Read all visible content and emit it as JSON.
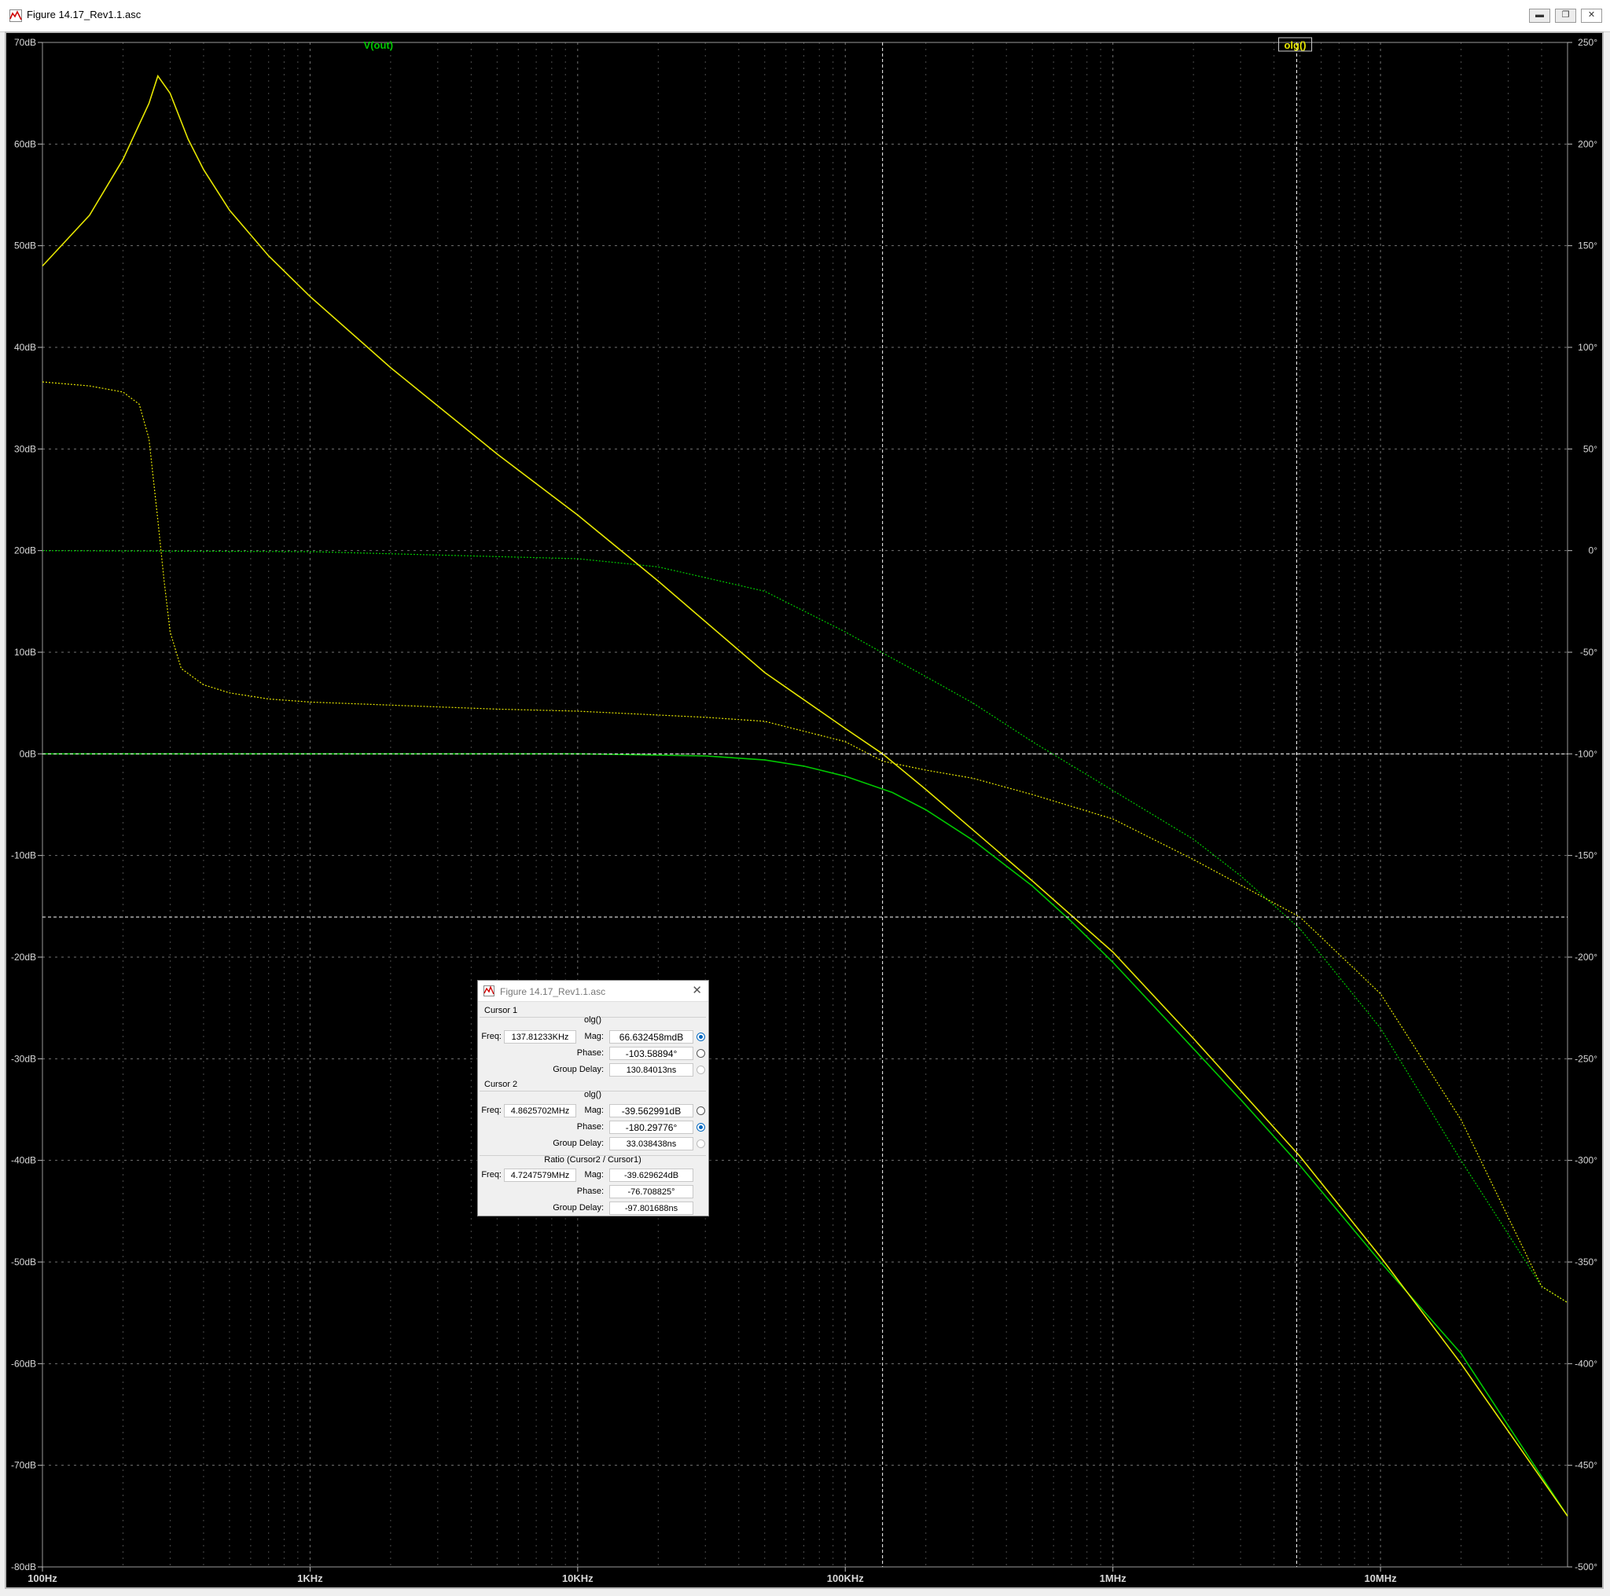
{
  "window": {
    "title": "Figure 14.17_Rev1.1.asc"
  },
  "window_buttons": {
    "minimize": "▬",
    "restore": "❐",
    "close": "✕"
  },
  "icons": {
    "app": "ltspice-plot-icon",
    "dialog": "ltspice-plot-icon"
  },
  "colors": {
    "background": "#000000",
    "grid": "#7f7f7f",
    "trace_vout": "#00c800",
    "trace_olg": "#e6e600",
    "cursor": "#ffffff"
  },
  "chart_data": {
    "type": "line",
    "xscale": "log",
    "xlim": [
      100,
      50000000
    ],
    "x_ticks": [
      {
        "value": 100,
        "label": "100Hz"
      },
      {
        "value": 1000,
        "label": "1KHz"
      },
      {
        "value": 10000,
        "label": "10KHz"
      },
      {
        "value": 100000,
        "label": "100KHz"
      },
      {
        "value": 1000000,
        "label": "1MHz"
      },
      {
        "value": 10000000,
        "label": "10MHz"
      }
    ],
    "ylim_left": [
      -80,
      70
    ],
    "y_left_ticks": [
      "70dB",
      "60dB",
      "50dB",
      "40dB",
      "30dB",
      "20dB",
      "10dB",
      "0dB",
      "-10dB",
      "-20dB",
      "-30dB",
      "-40dB",
      "-50dB",
      "-60dB",
      "-70dB",
      "-80dB"
    ],
    "y_left_values": [
      70,
      60,
      50,
      40,
      30,
      20,
      10,
      0,
      -10,
      -20,
      -30,
      -40,
      -50,
      -60,
      -70,
      -80
    ],
    "ylim_right": [
      -500,
      250
    ],
    "y_right_ticks": [
      "250°",
      "200°",
      "150°",
      "100°",
      "50°",
      "0°",
      "-50°",
      "-100°",
      "-150°",
      "-200°",
      "-250°",
      "-300°",
      "-350°",
      "-400°",
      "-450°",
      "-500°"
    ],
    "y_right_values": [
      250,
      200,
      150,
      100,
      50,
      0,
      -50,
      -100,
      -150,
      -200,
      -250,
      -300,
      -350,
      -400,
      -450,
      -500
    ],
    "grid": true,
    "series": [
      {
        "name": "V(out)",
        "quantity": "magnitude",
        "axis": "left",
        "unit": "dB",
        "x": [
          100,
          1000,
          10000,
          30000,
          50000,
          70000,
          100000,
          150000,
          200000,
          300000,
          500000,
          700000,
          1000000,
          2000000,
          3000000,
          5000000,
          10000000,
          20000000,
          50000000
        ],
        "y": [
          0,
          0,
          0,
          -0.2,
          -0.6,
          -1.2,
          -2.2,
          -3.8,
          -5.5,
          -8.5,
          -13,
          -16.5,
          -20.5,
          -29,
          -34,
          -40.5,
          -50,
          -59,
          -75
        ]
      },
      {
        "name": "V(out)",
        "quantity": "phase",
        "axis": "right",
        "unit": "°",
        "x": [
          100,
          1000,
          10000,
          20000,
          50000,
          100000,
          150000,
          200000,
          300000,
          500000,
          1000000,
          2000000,
          3000000,
          5000000,
          10000000,
          20000000,
          40000000,
          50000000
        ],
        "y": [
          0,
          -0.5,
          -4,
          -8,
          -20,
          -40,
          -53,
          -62,
          -75,
          -94,
          -118,
          -142,
          -160,
          -186,
          -235,
          -300,
          -362,
          -370
        ]
      },
      {
        "name": "olg()",
        "quantity": "magnitude",
        "axis": "left",
        "unit": "dB",
        "x": [
          100,
          150,
          200,
          250,
          270,
          300,
          350,
          400,
          500,
          700,
          1000,
          2000,
          5000,
          10000,
          20000,
          50000,
          100000,
          137812,
          200000,
          500000,
          1000000,
          2000000,
          5000000,
          10000000,
          20000000,
          50000000
        ],
        "y": [
          48,
          53,
          58.5,
          64,
          66.7,
          65,
          60.5,
          57.5,
          53.5,
          49,
          45,
          38,
          29.5,
          23.5,
          17,
          8,
          2.5,
          0,
          -3.5,
          -12.5,
          -19.5,
          -28,
          -39.6,
          -49.5,
          -60,
          -75
        ]
      },
      {
        "name": "olg()",
        "quantity": "phase",
        "axis": "right",
        "unit": "°",
        "x": [
          100,
          150,
          200,
          230,
          250,
          270,
          285,
          300,
          330,
          400,
          500,
          700,
          1000,
          2000,
          5000,
          10000,
          30000,
          50000,
          100000,
          137812,
          200000,
          300000,
          500000,
          1000000,
          2000000,
          5000000,
          10000000,
          20000000,
          40000000,
          50000000
        ],
        "y": [
          83,
          81,
          78,
          72,
          55,
          15,
          -15,
          -40,
          -58,
          -66,
          -70,
          -73,
          -74.5,
          -76,
          -78,
          -79,
          -82,
          -84,
          -94,
          -103.6,
          -108,
          -112,
          -120,
          -132,
          -152,
          -180.3,
          -218,
          -280,
          -362,
          -370
        ]
      }
    ],
    "trace_labels": [
      {
        "text": "V(out)",
        "color": "#00c800"
      },
      {
        "text": "olg()",
        "color": "#e6e600",
        "selected": true
      }
    ],
    "cursors": [
      {
        "freq": 137812.33,
        "mag_db": 0,
        "phase_deg": -103.58894,
        "style": "dashed"
      },
      {
        "freq": 4862570.2,
        "mag_db": -39.562991,
        "phase_deg": -180.29776,
        "style": "dashed"
      }
    ]
  },
  "dialog": {
    "title": "Figure 14.17_Rev1.1.asc",
    "close": "✕",
    "cursor1": {
      "header": "Cursor 1",
      "trace": "olg()",
      "freq_label": "Freq:",
      "freq": "137.81233KHz",
      "mag_label": "Mag:",
      "mag": "66.632458mdB",
      "phase_label": "Phase:",
      "phase": "-103.58894°",
      "gd_label": "Group Delay:",
      "gd": "130.84013ns"
    },
    "cursor2": {
      "header": "Cursor 2",
      "trace": "olg()",
      "freq_label": "Freq:",
      "freq": "4.8625702MHz",
      "mag_label": "Mag:",
      "mag": "-39.562991dB",
      "phase_label": "Phase:",
      "phase": "-180.29776°",
      "gd_label": "Group Delay:",
      "gd": "33.038438ns"
    },
    "ratio": {
      "header": "Ratio (Cursor2 / Cursor1)",
      "freq_label": "Freq:",
      "freq": "4.7247579MHz",
      "mag_label": "Mag:",
      "mag": "-39.629624dB",
      "phase_label": "Phase:",
      "phase": "-76.708825°",
      "gd_label": "Group Delay:",
      "gd": "-97.801688ns"
    }
  }
}
